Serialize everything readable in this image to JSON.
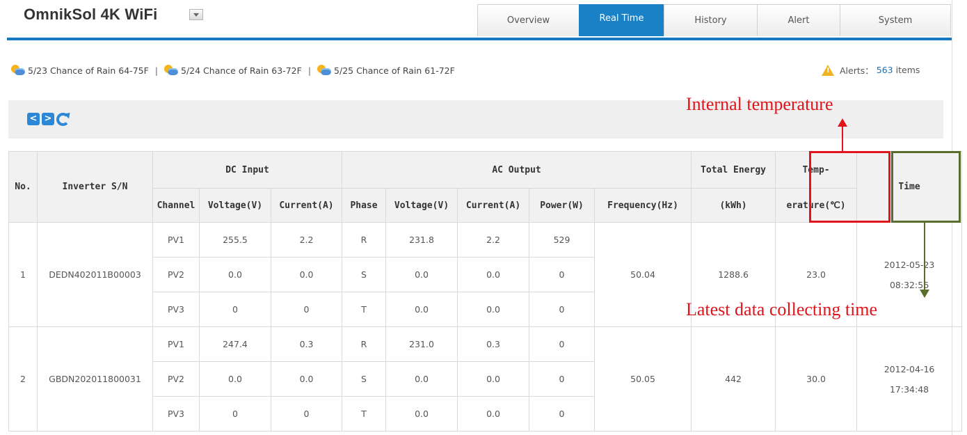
{
  "header": {
    "title": "OmnikSol 4K WiFi",
    "tabs": [
      "Overview",
      "Real Time",
      "History",
      "Alert",
      "System"
    ],
    "active_tab": "Real Time"
  },
  "weather": [
    {
      "icon": "partly-cloudy-icon",
      "text": "5/23 Chance of Rain 64-75F"
    },
    {
      "icon": "partly-cloudy-icon",
      "text": "5/24 Chance of Rain 63-72F"
    },
    {
      "icon": "partly-cloudy-icon",
      "text": "5/25 Chance of Rain 61-72F"
    }
  ],
  "weather_sep": "|",
  "alerts": {
    "label": "Alerts：",
    "count": "563",
    "suffix": "items"
  },
  "toolbar": {
    "prev": "<",
    "next": ">"
  },
  "table": {
    "group_headers": {
      "no": "No.",
      "sn": "Inverter S/N",
      "dc": "DC Input",
      "ac": "AC Output",
      "energy": "Total Energy",
      "temp": "Temp-",
      "time": "Time"
    },
    "sub_headers": {
      "channel": "Channel",
      "dc_voltage": "Voltage(V)",
      "dc_current": "Current(A)",
      "phase": "Phase",
      "ac_voltage": "Voltage(V)",
      "ac_current": "Current(A)",
      "power": "Power(W)",
      "frequency": "Frequency(Hz)",
      "energy_unit": "(kWh)",
      "temp_unit": "erature(℃)"
    },
    "inverters": [
      {
        "no": "1",
        "sn": "DEDN402011B00003",
        "frequency": "50.04",
        "energy": "1288.6",
        "temp": "23.0",
        "date": "2012-05-23",
        "time": "08:32:56",
        "rows": [
          {
            "channel": "PV1",
            "dc_v": "255.5",
            "dc_a": "2.2",
            "phase": "R",
            "ac_v": "231.8",
            "ac_a": "2.2",
            "power": "529"
          },
          {
            "channel": "PV2",
            "dc_v": "0.0",
            "dc_a": "0.0",
            "phase": "S",
            "ac_v": "0.0",
            "ac_a": "0.0",
            "power": "0"
          },
          {
            "channel": "PV3",
            "dc_v": "0",
            "dc_a": "0",
            "phase": "T",
            "ac_v": "0.0",
            "ac_a": "0.0",
            "power": "0"
          }
        ]
      },
      {
        "no": "2",
        "sn": "GBDN202011800031",
        "frequency": "50.05",
        "energy": "442",
        "temp": "30.0",
        "date": "2012-04-16",
        "time": "17:34:48",
        "rows": [
          {
            "channel": "PV1",
            "dc_v": "247.4",
            "dc_a": "0.3",
            "phase": "R",
            "ac_v": "231.0",
            "ac_a": "0.3",
            "power": "0"
          },
          {
            "channel": "PV2",
            "dc_v": "0.0",
            "dc_a": "0.0",
            "phase": "S",
            "ac_v": "0.0",
            "ac_a": "0.0",
            "power": "0"
          },
          {
            "channel": "PV3",
            "dc_v": "0",
            "dc_a": "0",
            "phase": "T",
            "ac_v": "0.0",
            "ac_a": "0.0",
            "power": "0"
          }
        ]
      }
    ]
  },
  "annotations": {
    "internal_temp": "Internal temperature",
    "latest_time": "Latest data collecting time"
  },
  "colors": {
    "accent": "#1479be",
    "annotation_red": "#e2141b",
    "annotation_green": "#5a6d2c"
  }
}
